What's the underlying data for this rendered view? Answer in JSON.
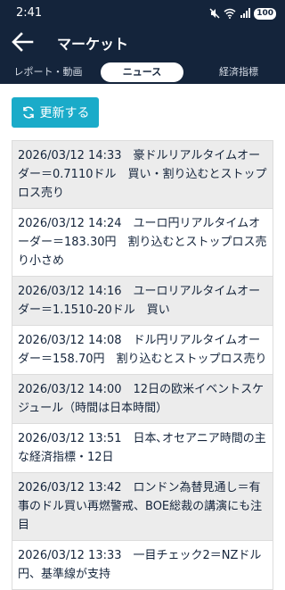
{
  "status_bar": {
    "time": "2:41",
    "battery": "100"
  },
  "appbar": {
    "title": "マーケット"
  },
  "tabs": [
    {
      "label": "レポート・動画"
    },
    {
      "label": "ニュース"
    },
    {
      "label": "経済指標"
    }
  ],
  "refresh": {
    "label": "更新する"
  },
  "news": [
    {
      "text": "2026/03/12 14:33　豪ドルリアルタイムオーダー＝0.7110ドル　買い・割り込むとストップロス売り"
    },
    {
      "text": "2026/03/12 14:24　ユーロ円リアルタイムオーダー＝183.30円　割り込むとストップロス売り小さめ"
    },
    {
      "text": "2026/03/12 14:16　ユーロリアルタイムオーダー＝1.1510-20ドル　買い"
    },
    {
      "text": "2026/03/12 14:08　ドル円リアルタイムオーダー＝158.70円　割り込むとストップロス売り"
    },
    {
      "text": "2026/03/12 14:00　12日の欧米イベントスケジュール（時間は日本時間）"
    },
    {
      "text": "2026/03/12 13:51　日本､オセアニア時間の主な経済指標・12日"
    },
    {
      "text": "2026/03/12 13:42　ロンドン為替見通し＝有事のドル買い再燃警戒、BOE総裁の講演にも注目"
    },
    {
      "text": "2026/03/12 13:33　一目チェック2＝NZドル円、基準線が支持"
    }
  ],
  "colors": {
    "header": "#14243b",
    "accent": "#1aabc9",
    "alt_row": "#ececec"
  }
}
